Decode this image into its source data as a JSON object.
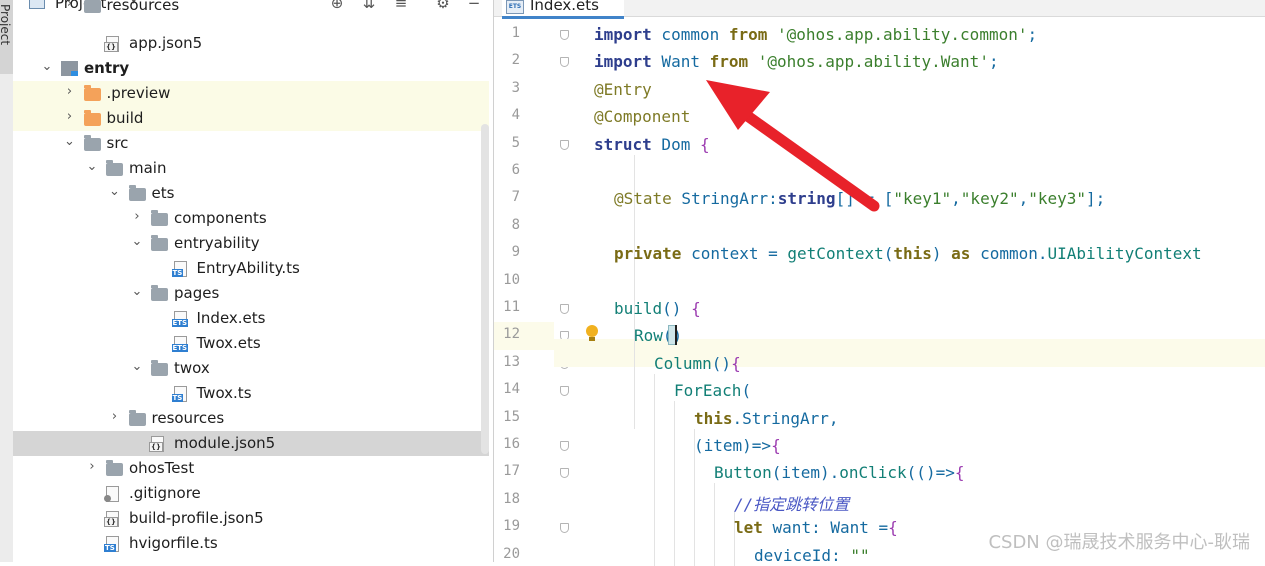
{
  "side_tab": "Project",
  "project_panel": {
    "title": "Project",
    "tree": [
      {
        "label": "resources",
        "chev": "›",
        "icon": "folder",
        "indent": 1,
        "row": 0,
        "partial": true
      },
      {
        "label": "app.json5",
        "chev": "",
        "icon": "json",
        "indent": 2,
        "row": 1
      },
      {
        "label": "entry",
        "chev": "⌄",
        "icon": "module",
        "indent": 0,
        "row": 2,
        "bold": true
      },
      {
        "label": ".preview",
        "chev": "›",
        "icon": "folder-orange",
        "indent": 1,
        "row": 3,
        "highlight": "yellow"
      },
      {
        "label": "build",
        "chev": "›",
        "icon": "folder-orange",
        "indent": 1,
        "row": 4,
        "highlight": "yellow"
      },
      {
        "label": "src",
        "chev": "⌄",
        "icon": "folder",
        "indent": 1,
        "row": 5
      },
      {
        "label": "main",
        "chev": "⌄",
        "icon": "folder",
        "indent": 2,
        "row": 6
      },
      {
        "label": "ets",
        "chev": "⌄",
        "icon": "folder",
        "indent": 3,
        "row": 7
      },
      {
        "label": "components",
        "chev": "›",
        "icon": "folder",
        "indent": 4,
        "row": 8
      },
      {
        "label": "entryability",
        "chev": "⌄",
        "icon": "folder",
        "indent": 4,
        "row": 9
      },
      {
        "label": "EntryAbility.ts",
        "chev": "",
        "icon": "ts",
        "indent": 5,
        "row": 10
      },
      {
        "label": "pages",
        "chev": "⌄",
        "icon": "folder",
        "indent": 4,
        "row": 11
      },
      {
        "label": "Index.ets",
        "chev": "",
        "icon": "ets",
        "indent": 5,
        "row": 12
      },
      {
        "label": "Twox.ets",
        "chev": "",
        "icon": "ets",
        "indent": 5,
        "row": 13
      },
      {
        "label": "twox",
        "chev": "⌄",
        "icon": "folder",
        "indent": 4,
        "row": 14
      },
      {
        "label": "Twox.ts",
        "chev": "",
        "icon": "ts",
        "indent": 5,
        "row": 15
      },
      {
        "label": "resources",
        "chev": "›",
        "icon": "folder",
        "indent": 3,
        "row": 16
      },
      {
        "label": "module.json5",
        "chev": "",
        "icon": "json",
        "indent": 4,
        "row": 17,
        "highlight": "gray"
      },
      {
        "label": "ohosTest",
        "chev": "›",
        "icon": "folder",
        "indent": 2,
        "row": 18
      },
      {
        "label": ".gitignore",
        "chev": "",
        "icon": "git",
        "indent": 2,
        "row": 19
      },
      {
        "label": "build-profile.json5",
        "chev": "",
        "icon": "json",
        "indent": 2,
        "row": 20
      },
      {
        "label": "hvigorfile.ts",
        "chev": "",
        "icon": "ts",
        "indent": 2,
        "row": 21
      }
    ]
  },
  "editor": {
    "tab": {
      "title": "Index.ets",
      "badge": "ETS"
    },
    "line_numbers": [
      "1",
      "2",
      "3",
      "4",
      "5",
      "6",
      "7",
      "8",
      "9",
      "10",
      "11",
      "12",
      "13",
      "14",
      "15",
      "16",
      "17",
      "18",
      "19",
      "20"
    ],
    "lines": [
      {
        "indent": 0,
        "tokens": [
          [
            "kw",
            "import"
          ],
          [
            "typ",
            " common "
          ],
          [
            "kw2",
            "from"
          ],
          [
            "str",
            " '@ohos.app.ability.common'"
          ],
          [
            "typ",
            ";"
          ]
        ]
      },
      {
        "indent": 0,
        "tokens": [
          [
            "kw",
            "import"
          ],
          [
            "typ",
            " Want "
          ],
          [
            "kw2",
            "from"
          ],
          [
            "str",
            " '@ohos.app.ability.Want'"
          ],
          [
            "typ",
            ";"
          ]
        ]
      },
      {
        "indent": 0,
        "tokens": [
          [
            "ann",
            "@Entry"
          ]
        ]
      },
      {
        "indent": 0,
        "tokens": [
          [
            "ann",
            "@Component"
          ]
        ]
      },
      {
        "indent": 0,
        "tokens": [
          [
            "kw",
            "struct"
          ],
          [
            "typ",
            " Dom "
          ],
          [
            "pn",
            "{"
          ]
        ]
      },
      {
        "indent": 0,
        "tokens": []
      },
      {
        "indent": 1,
        "tokens": [
          [
            "ann",
            "@State"
          ],
          [
            "typ",
            " StringArr:"
          ],
          [
            "kw",
            "string"
          ],
          [
            "typ",
            "[] = ["
          ],
          [
            "str",
            "\"key1\""
          ],
          [
            "typ",
            ","
          ],
          [
            "str",
            "\"key2\""
          ],
          [
            "typ",
            ","
          ],
          [
            "str",
            "\"key3\""
          ],
          [
            "typ",
            "];"
          ]
        ]
      },
      {
        "indent": 0,
        "tokens": []
      },
      {
        "indent": 1,
        "tokens": [
          [
            "kw2",
            "private"
          ],
          [
            "typ",
            " context = "
          ],
          [
            "fn",
            "getContext"
          ],
          [
            "typ",
            "("
          ],
          [
            "kw2",
            "this"
          ],
          [
            "typ",
            ") "
          ],
          [
            "kw2",
            "as"
          ],
          [
            "typ",
            " common."
          ],
          [
            "fn",
            "UIAbilityContext"
          ]
        ]
      },
      {
        "indent": 0,
        "tokens": []
      },
      {
        "indent": 1,
        "tokens": [
          [
            "fn",
            "build"
          ],
          [
            "typ",
            "() "
          ],
          [
            "pn",
            "{"
          ]
        ]
      },
      {
        "indent": 2,
        "tokens": [
          [
            "fn",
            "Row"
          ],
          [
            "typ",
            "() "
          ]
        ]
      },
      {
        "indent": 3,
        "tokens": [
          [
            "fn",
            "Column"
          ],
          [
            "typ",
            "()"
          ],
          [
            "pn",
            "{"
          ]
        ]
      },
      {
        "indent": 4,
        "tokens": [
          [
            "fn",
            "ForEach"
          ],
          [
            "typ",
            "("
          ]
        ]
      },
      {
        "indent": 5,
        "tokens": [
          [
            "kw2",
            "this"
          ],
          [
            "typ",
            ".StringArr,"
          ]
        ]
      },
      {
        "indent": 5,
        "tokens": [
          [
            "typ",
            "(item)=>"
          ],
          [
            "pn",
            "{"
          ]
        ]
      },
      {
        "indent": 6,
        "tokens": [
          [
            "fn",
            "Button"
          ],
          [
            "typ",
            "(item)."
          ],
          [
            "fn",
            "onClick"
          ],
          [
            "typ",
            "(()=>"
          ],
          [
            "pn",
            "{"
          ]
        ]
      },
      {
        "indent": 7,
        "tokens": [
          [
            "cm",
            "//指定跳转位置"
          ]
        ]
      },
      {
        "indent": 7,
        "tokens": [
          [
            "kw2",
            "let"
          ],
          [
            "typ",
            " want: Want ="
          ],
          [
            "pn",
            "{"
          ]
        ]
      },
      {
        "indent": 8,
        "tokens": [
          [
            "typ",
            "deviceId: "
          ],
          [
            "str",
            "\"\""
          ]
        ]
      }
    ]
  },
  "watermark": "CSDN @瑞晟技术服务中心-耿瑞",
  "colors": {
    "accent_tab": "#4083c9",
    "arrow": "#e8222a",
    "selection_yellow": "#fbfbe6",
    "selection_gray": "#d5d5d5"
  }
}
